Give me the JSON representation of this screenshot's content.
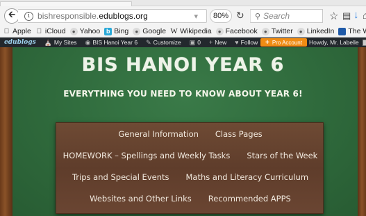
{
  "browser": {
    "url_prefix": "bishresponsible.",
    "url_domain": "edublogs.org",
    "zoom": "80%",
    "search_placeholder": "Search"
  },
  "bookmarks": [
    {
      "label": "Apple",
      "icon": "apple-icon"
    },
    {
      "label": "iCloud",
      "icon": "apple-icon"
    },
    {
      "label": "Yahoo",
      "icon": "globe-icon"
    },
    {
      "label": "Bing",
      "icon": "bing-icon"
    },
    {
      "label": "Google",
      "icon": "globe-icon"
    },
    {
      "label": "Wikipedia",
      "icon": "wikipedia-icon"
    },
    {
      "label": "Facebook",
      "icon": "globe-icon"
    },
    {
      "label": "Twitter",
      "icon": "globe-icon"
    },
    {
      "label": "LinkedIn",
      "icon": "globe-icon"
    },
    {
      "label": "The Weather Channel",
      "icon": "weather-icon"
    }
  ],
  "adminbar": {
    "logo": "edublogs",
    "my_sites": "My Sites",
    "site_name": "BIS Hanoi Year 6",
    "customize": "Customize",
    "comments": "0",
    "new": "New",
    "follow": "Follow",
    "pro": "Pro Account",
    "howdy": "Howdy, Mr. Labelle"
  },
  "site": {
    "title": "BIS HANOI YEAR 6",
    "subtitle": "EVERYTHING YOU NEED TO KNOW ABOUT YEAR 6!",
    "menu_rows": [
      [
        "General Information",
        "Class Pages"
      ],
      [
        "HOMEWORK – Spellings and Weekly Tasks",
        "Stars of the Week"
      ],
      [
        "Trips and Special Events",
        "Maths and Literacy Curriculum"
      ],
      [
        "Websites and Other Links",
        "Recommended APPS"
      ]
    ]
  },
  "colors": {
    "chalkboard": "#2f6a3c",
    "wood": "#6e4a34",
    "adminbar": "#23282d",
    "pro_accent": "#f08c14"
  }
}
